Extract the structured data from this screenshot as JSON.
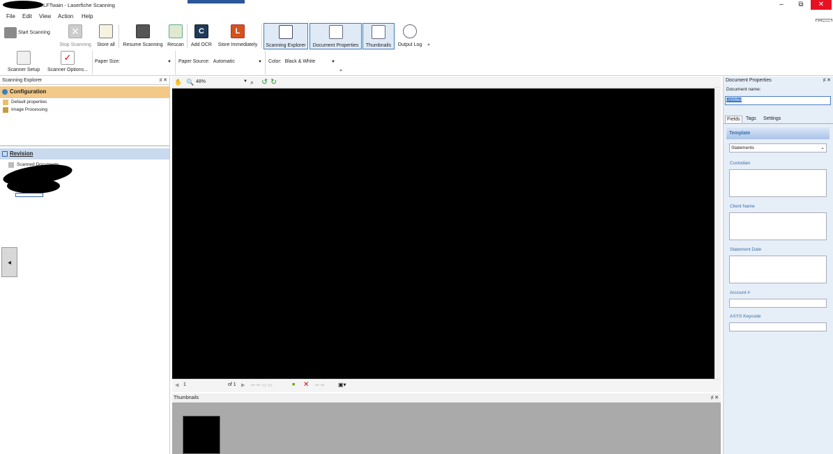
{
  "window": {
    "title": "LFTwain - Laserfiche Scanning",
    "close_tooltip": "Close",
    "minimize": "–",
    "restore": "⧉",
    "close": "✕"
  },
  "menu": [
    "File",
    "Edit",
    "View",
    "Action",
    "Help"
  ],
  "ribbon": {
    "start_scanning": "Start Scanning",
    "stop_scanning": "Stop Scanning",
    "store_all": "Store all",
    "resume_scanning": "Resume Scanning",
    "rescan": "Rescan",
    "add_ocr": "Add OCR",
    "store_immediately": "Store Immediately",
    "scanning_explorer": "Scanning Explorer",
    "document_properties": "Document Properties",
    "thumbnails": "Thumbnails",
    "output_log": "Output Log",
    "scanner_setup": "Scanner Setup",
    "scanner_options": "Scanner Options...",
    "paper_size_label": "Paper Size:",
    "paper_size_value": "",
    "paper_source_label": "Paper Source:",
    "paper_source_value": "Automatic",
    "color_label": "Color:",
    "color_value": "Black & White"
  },
  "left": {
    "title": "Scanning Explorer",
    "configuration": "Configuration",
    "default_properties": "Default properties",
    "image_processing": "Image Processing",
    "revision": "Revision",
    "scanned_documents": "Scanned Documents"
  },
  "viewer": {
    "zoom": "48%",
    "page": "1",
    "of": "of 1"
  },
  "thumbnails": {
    "title": "Thumbnails"
  },
  "right": {
    "title": "Document Properties",
    "doc_name_label": "Document name:",
    "doc_name_value": "Untitled",
    "tabs": [
      "Fields",
      "Tags",
      "Settings"
    ],
    "template_label": "Template",
    "template_value": "Statements",
    "fields": [
      "Custodian",
      "Client Name",
      "Statement Date",
      "Account #",
      "AXYS Keycode"
    ]
  }
}
